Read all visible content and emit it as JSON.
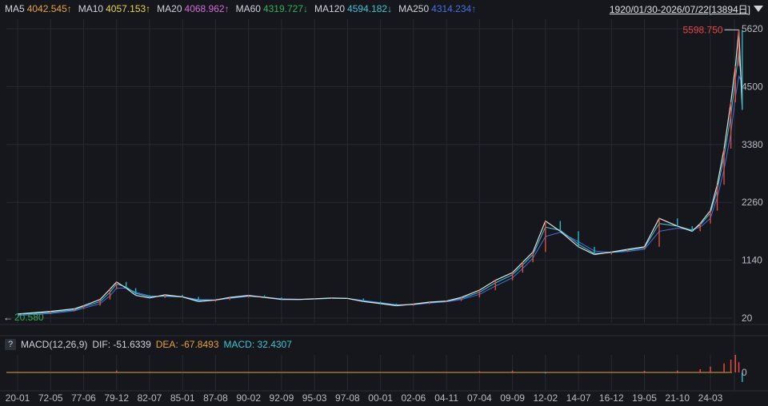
{
  "ma_legend": [
    {
      "label": "MA5",
      "value": "4042.545↑",
      "color": "#e8a23a"
    },
    {
      "label": "MA10",
      "value": "4057.153↑",
      "color": "#e9d548"
    },
    {
      "label": "MA20",
      "value": "4068.962↑",
      "color": "#d86ad8"
    },
    {
      "label": "MA60",
      "value": "4319.727↓",
      "color": "#2fb25a"
    },
    {
      "label": "MA120",
      "value": "4594.182↓",
      "color": "#3ec6d6"
    },
    {
      "label": "MA250",
      "value": "4314.234↑",
      "color": "#4a6fe0"
    }
  ],
  "date_range": "1920/01/30-2026/07/22[13894日]",
  "max_label": "5598.750",
  "min_label": "20.580",
  "macd": {
    "name": "MACD(12,26,9)",
    "dif_label": "DIF:",
    "dif_value": "-51.6339",
    "dea_label": "DEA:",
    "dea_value": "-67.8493",
    "macd_label": "MACD:",
    "macd_value": "32.4307"
  },
  "colors": {
    "up": "#e64b3c",
    "down": "#1fb8c6",
    "price": "#e0e0e0",
    "grid": "#262a33",
    "axis_text": "#b8bdc6",
    "max": "#e84545",
    "min": "#2fb25a"
  },
  "chart_data": {
    "type": "line",
    "title": "",
    "x_ticks": [
      "20-01",
      "72-05",
      "77-06",
      "79-12",
      "82-07",
      "85-01",
      "87-08",
      "90-02",
      "92-09",
      "95-03",
      "97-08",
      "00-01",
      "02-06",
      "04-11",
      "07-04",
      "09-09",
      "12-02",
      "14-07",
      "16-12",
      "19-05",
      "21-10",
      "24-03"
    ],
    "y_ticks": [
      20,
      1140,
      2260,
      3380,
      4500,
      5620
    ],
    "ylim": [
      20,
      5620
    ],
    "macd_y_ticks": [
      0
    ],
    "x": [
      "20-01",
      "72-05",
      "76-01",
      "77-06",
      "78-09",
      "79-06",
      "79-12",
      "80-09",
      "81-06",
      "82-07",
      "83-09",
      "85-01",
      "86-04",
      "87-08",
      "88-09",
      "90-02",
      "91-05",
      "92-09",
      "94-01",
      "95-03",
      "96-06",
      "97-08",
      "98-10",
      "00-01",
      "01-03",
      "02-06",
      "03-08",
      "04-11",
      "05-12",
      "07-04",
      "08-06",
      "09-09",
      "10-06",
      "11-03",
      "12-02",
      "13-03",
      "14-07",
      "15-09",
      "16-12",
      "18-02",
      "19-05",
      "20-06",
      "21-10",
      "22-11",
      "23-06",
      "24-03",
      "24-09",
      "25-03",
      "25-09",
      "26-01",
      "26-04",
      "26-07"
    ],
    "series": [
      {
        "kind": "price",
        "values": [
          100,
          150,
          200,
          260,
          380,
          580,
          720,
          600,
          460,
          410,
          470,
          430,
          340,
          370,
          420,
          460,
          420,
          380,
          380,
          395,
          410,
          400,
          340,
          300,
          260,
          290,
          330,
          350,
          420,
          560,
          750,
          900,
          1100,
          1300,
          1900,
          1700,
          1400,
          1250,
          1300,
          1350,
          1400,
          1950,
          1800,
          1700,
          1850,
          2100,
          2600,
          3300,
          4200,
          4900,
          5598,
          4050
        ]
      },
      {
        "kind": "ma",
        "values": [
          90,
          130,
          180,
          240,
          340,
          520,
          680,
          620,
          500,
          430,
          450,
          430,
          360,
          370,
          410,
          450,
          425,
          385,
          380,
          390,
          405,
          400,
          350,
          310,
          270,
          285,
          320,
          345,
          400,
          520,
          700,
          860,
          1050,
          1250,
          1780,
          1720,
          1450,
          1270,
          1290,
          1330,
          1380,
          1850,
          1800,
          1720,
          1820,
          2050,
          2500,
          3150,
          3950,
          4650,
          5200,
          4320
        ]
      },
      {
        "kind": "ma",
        "values": [
          70,
          110,
          160,
          210,
          300,
          450,
          600,
          600,
          520,
          450,
          440,
          430,
          380,
          370,
          400,
          440,
          425,
          395,
          385,
          388,
          400,
          400,
          360,
          320,
          280,
          280,
          310,
          335,
          380,
          480,
          640,
          800,
          980,
          1180,
          1600,
          1680,
          1500,
          1320,
          1290,
          1310,
          1350,
          1700,
          1760,
          1730,
          1780,
          1950,
          2350,
          2900,
          3600,
          4300,
          4700,
          4590
        ]
      }
    ],
    "macd_x": [
      "20-01",
      "72-05",
      "77-06",
      "79-12",
      "82-07",
      "85-01",
      "87-08",
      "90-02",
      "92-09",
      "95-03",
      "97-08",
      "00-01",
      "02-06",
      "04-11",
      "07-04",
      "09-09",
      "12-02",
      "14-07",
      "16-12",
      "19-05",
      "21-10",
      "23-06",
      "24-03",
      "25-03",
      "25-09",
      "26-01",
      "26-04",
      "26-07"
    ],
    "macd_values": [
      0,
      1,
      2,
      6,
      2,
      1,
      1,
      0,
      1,
      0,
      0,
      -1,
      1,
      2,
      4,
      6,
      -3,
      2,
      2,
      5,
      6,
      10,
      18,
      28,
      40,
      55,
      32,
      -30
    ]
  }
}
